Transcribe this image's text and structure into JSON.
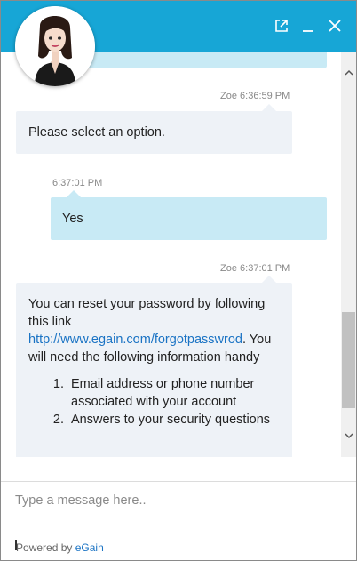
{
  "header": {
    "background_color": "#17a6d6",
    "popout_icon": "popout-icon",
    "minimize_icon": "minimize-icon",
    "close_icon": "close-icon"
  },
  "agent": {
    "avatar_icon": "agent-avatar"
  },
  "messages": [
    {
      "type": "agent",
      "sender": "Zoe",
      "time": "6:36:59 PM",
      "text": "Please select an option."
    },
    {
      "type": "user",
      "time": "6:37:01 PM",
      "text": "Yes"
    },
    {
      "type": "agent",
      "sender": "Zoe",
      "time": "6:37:01 PM",
      "text_line1": "You can reset your password by following this link",
      "link": "http://www.egain.com/forgotpasswrod",
      "text_after_link": ".",
      "text_line2": "You will need the following information handy",
      "list": [
        "Email address or phone number associated with your account",
        "Answers to your security questions"
      ]
    }
  ],
  "composer": {
    "placeholder": "Type a message here.."
  },
  "footer": {
    "powered_by": "owered by",
    "brand": "eGain"
  },
  "colors": {
    "agent_bubble": "#eef2f7",
    "user_bubble": "#c8eaf5",
    "link": "#1a73c4"
  }
}
